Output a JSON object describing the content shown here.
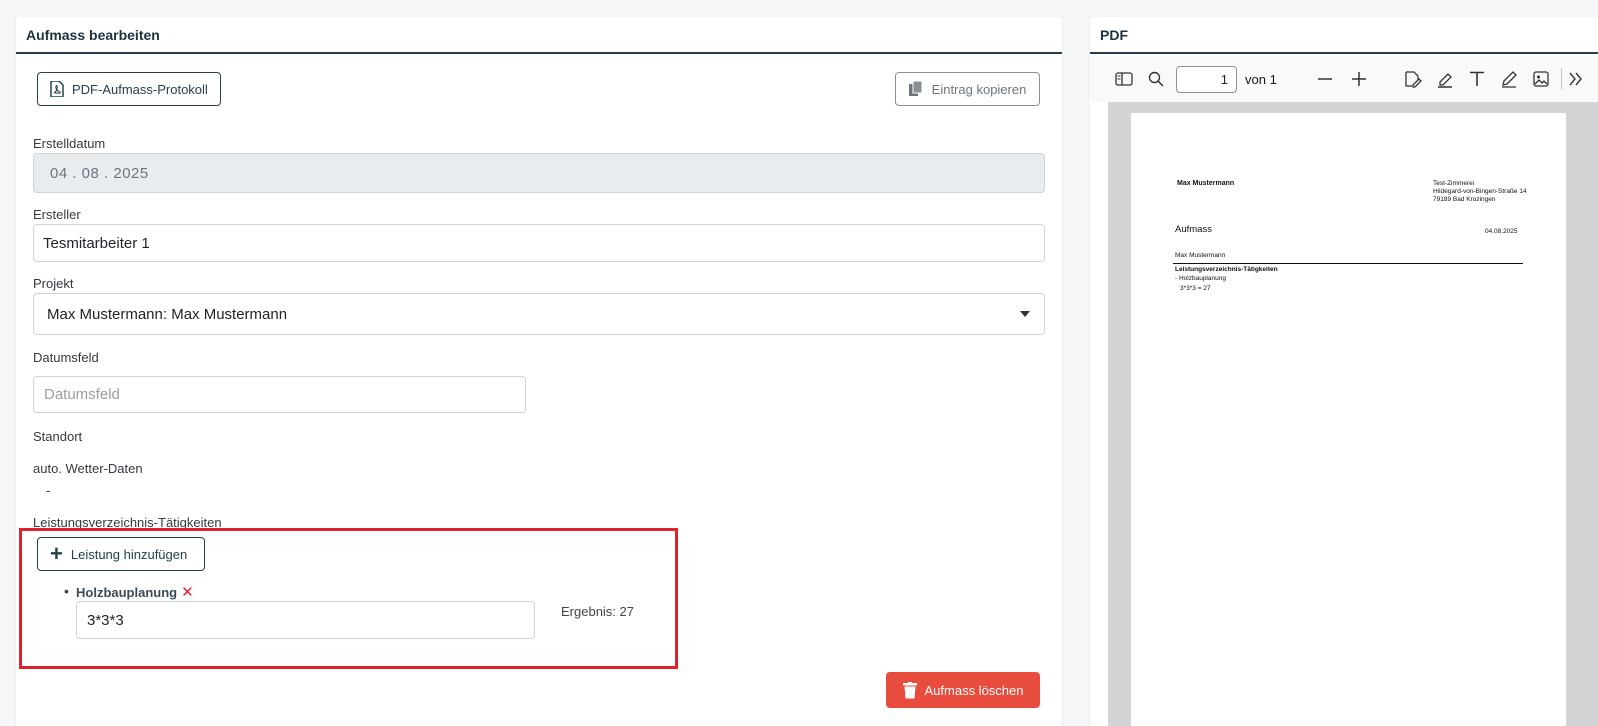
{
  "edit": {
    "title": "Aufmass bearbeiten",
    "pdf_button": "PDF-Aufmass-Protokoll",
    "copy_button": "Eintrag kopieren",
    "erstelldatum_label": "Erstelldatum",
    "erstelldatum_value": "04 . 08 . 2025",
    "ersteller_label": "Ersteller",
    "ersteller_value": "Tesmitarbeiter  1",
    "projekt_label": "Projekt",
    "projekt_value": "Max Mustermann: Max Mustermann",
    "datumsfeld_label": "Datumsfeld",
    "datumsfeld_placeholder": "Datumsfeld",
    "standort_label": "Standort",
    "wetter_label": "auto. Wetter-Daten",
    "wetter_value": "-",
    "leistung_label": "Leistungsverzeichnis-Tätigkeiten",
    "add_button": "Leistung hinzufügen",
    "item_name": "Holzbauplanung",
    "item_formula": "3*3*3",
    "item_result": "Ergebnis: 27",
    "delete_button": "Aufmass löschen"
  },
  "pdf": {
    "title": "PDF",
    "page_number": "1",
    "page_of": "von 1",
    "doc_name": "Max Mustermann",
    "company_line1": "Test-Zimmerei",
    "company_line2": "Hildegard-von-Bingen-Straße 14",
    "company_line3": "79189 Bad Krozingen",
    "doc_heading": "Aufmass",
    "doc_date": "04.08.2025",
    "doc_client": "Max Mustermann",
    "doc_section": "Leistungsverzeichnis-Tätigkeiten",
    "doc_item": "- Holzbauplanung",
    "doc_calc": "3*3*3 = 27"
  },
  "colors": {
    "primary": "#24404f",
    "danger": "#e74c3c",
    "highlight": "#e0202a"
  }
}
